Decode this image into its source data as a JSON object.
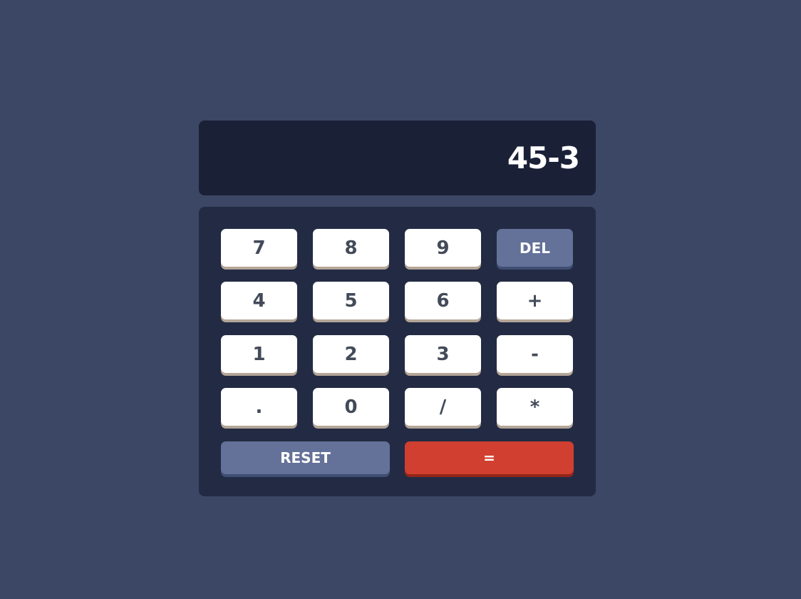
{
  "display": {
    "value": "45-3"
  },
  "keys": {
    "seven": "7",
    "eight": "8",
    "nine": "9",
    "del": "DEL",
    "four": "4",
    "five": "5",
    "six": "6",
    "plus": "+",
    "one": "1",
    "two": "2",
    "three": "3",
    "minus": "-",
    "decimal": ".",
    "zero": "0",
    "divide": "/",
    "multiply": "*",
    "reset": "RESET",
    "equals": "="
  },
  "colors": {
    "background": "#3b4764",
    "screen": "#1a2036",
    "keypad": "#232b44",
    "key": "#ffffff",
    "key_text": "#434a59",
    "accent_key": "#647198",
    "equals_key": "#d03f2f"
  }
}
